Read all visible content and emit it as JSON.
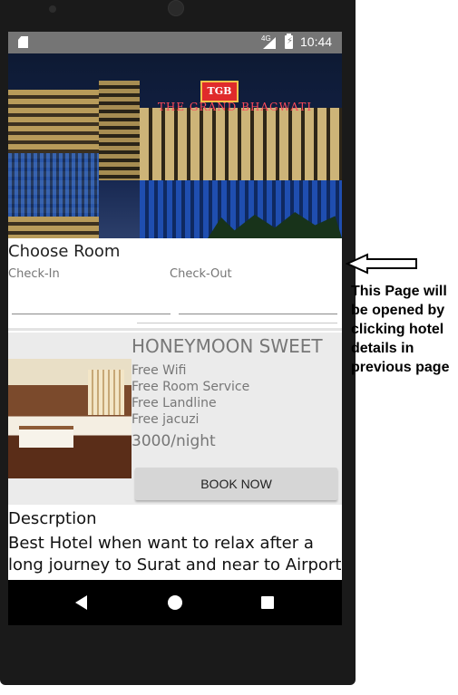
{
  "status_bar": {
    "network": "4G",
    "time": "10:44"
  },
  "hero": {
    "logo_text": "TGB",
    "sign_text": "THE GRAND BHAGWATI"
  },
  "booking": {
    "title": "Choose Room",
    "check_in_label": "Check-In",
    "check_out_label": "Check-Out",
    "check_in_value": "",
    "check_out_value": ""
  },
  "room": {
    "name": "HONEYMOON SWEET",
    "amenities": [
      "Free Wifi",
      "Free Room Service",
      "Free Landline",
      "Free jacuzi"
    ],
    "price": "3000/night",
    "book_label": "BOOK NOW"
  },
  "description": {
    "title": "Descrption",
    "text": "Best Hotel when want to relax after a long journey to Surat and near to Airport"
  },
  "annotation": {
    "text": "This Page will be opened by clicking hotel details in previous page"
  },
  "icons": [
    "sd-card-icon",
    "signal-icon",
    "battery-icon",
    "back-icon",
    "home-icon",
    "recent-apps-icon",
    "arrow-left-icon"
  ]
}
